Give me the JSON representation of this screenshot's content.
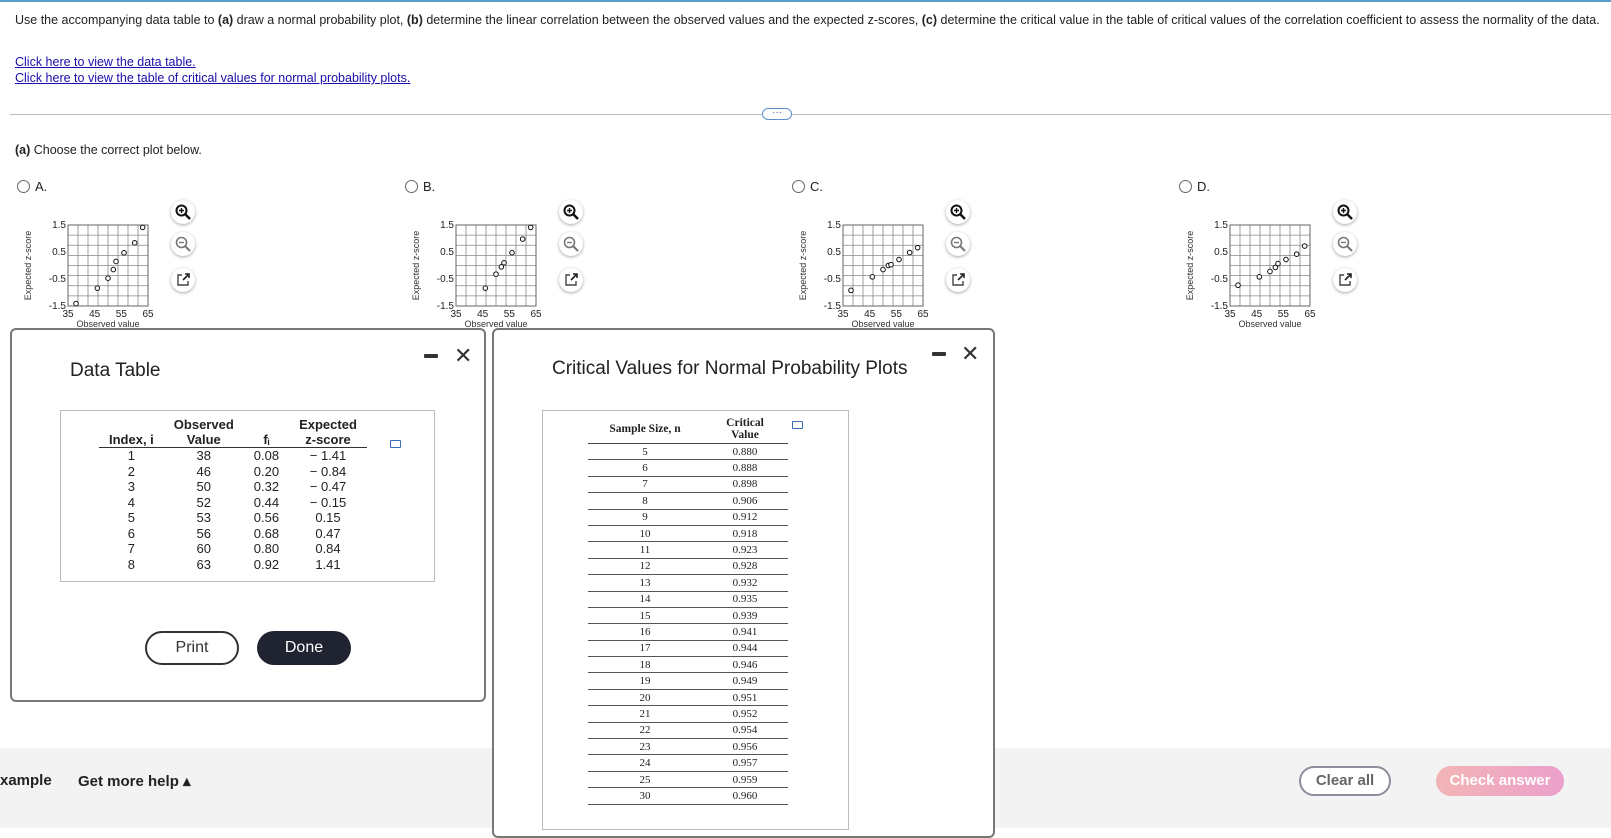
{
  "question": {
    "text_parts": [
      "Use the accompanying data table to ",
      "(a)",
      " draw a normal probability plot, ",
      "(b)",
      " determine the linear correlation between the observed values and the expected z-scores, ",
      "(c)",
      " determine the critical value in the table of critical values of the correlation coefficient to assess the normality of the data."
    ]
  },
  "links": {
    "data_table": "Click here to view the data table.",
    "critical_values": "Click here to view the table of critical values for normal probability plots."
  },
  "more_label": "···",
  "part_a": {
    "bold": "(a)",
    "text": " Choose the correct plot below."
  },
  "plot_axes": {
    "xlabel": "Observed value",
    "ylabel": "Expected z-score",
    "xticks": [
      "35",
      "45",
      "55",
      "65"
    ],
    "yticks": [
      "1.5",
      "0.5",
      "-0.5",
      "-1.5"
    ],
    "xlim": [
      35,
      65
    ],
    "ylim": [
      -1.5,
      1.5
    ]
  },
  "chart_data": [
    {
      "type": "scatter",
      "option": "A.",
      "x": [
        38,
        46,
        50,
        52,
        53,
        56,
        60,
        63
      ],
      "y": [
        -1.41,
        -0.84,
        -0.47,
        -0.15,
        0.15,
        0.47,
        0.84,
        1.41
      ],
      "xlabel": "Observed value",
      "ylabel": "Expected z-score",
      "xlim": [
        35,
        65
      ],
      "ylim": [
        -1.5,
        1.5
      ],
      "grid": true
    },
    {
      "type": "scatter",
      "option": "B.",
      "x": [
        46,
        50,
        52,
        53,
        56,
        60,
        63
      ],
      "y": [
        -0.84,
        -0.32,
        -0.05,
        0.1,
        0.47,
        0.98,
        1.41
      ],
      "xlabel": "Observed value",
      "ylabel": "Expected z-score",
      "xlim": [
        35,
        65
      ],
      "ylim": [
        -1.5,
        1.5
      ],
      "grid": true
    },
    {
      "type": "scatter",
      "option": "C.",
      "x": [
        38,
        46,
        50,
        52,
        53,
        56,
        60,
        63
      ],
      "y": [
        -0.92,
        -0.42,
        -0.15,
        0.0,
        0.03,
        0.22,
        0.48,
        0.66
      ],
      "xlabel": "Observed value",
      "ylabel": "Expected z-score",
      "xlim": [
        35,
        65
      ],
      "ylim": [
        -1.5,
        1.5
      ],
      "grid": true
    },
    {
      "type": "scatter",
      "option": "D.",
      "x": [
        38,
        46,
        50,
        52,
        53,
        56,
        60,
        63
      ],
      "y": [
        -0.73,
        -0.42,
        -0.22,
        -0.07,
        0.07,
        0.22,
        0.42,
        0.72
      ],
      "xlabel": "Observed value",
      "ylabel": "Expected z-score",
      "xlim": [
        35,
        65
      ],
      "ylim": [
        -1.5,
        1.5
      ],
      "grid": true
    }
  ],
  "icons": [
    "zoom-in-icon",
    "zoom-out-icon",
    "external-link-icon"
  ],
  "data_dialog": {
    "title": "Data Table",
    "headers": [
      [
        "",
        "Index, i"
      ],
      [
        "Observed",
        "Value"
      ],
      [
        "",
        "fᵢ"
      ],
      [
        "Expected",
        "z-score"
      ]
    ],
    "rows": [
      [
        "1",
        "38",
        "0.08",
        "− 1.41"
      ],
      [
        "2",
        "46",
        "0.20",
        "− 0.84"
      ],
      [
        "3",
        "50",
        "0.32",
        "− 0.47"
      ],
      [
        "4",
        "52",
        "0.44",
        "− 0.15"
      ],
      [
        "5",
        "53",
        "0.56",
        "0.15"
      ],
      [
        "6",
        "56",
        "0.68",
        "0.47"
      ],
      [
        "7",
        "60",
        "0.80",
        "0.84"
      ],
      [
        "8",
        "63",
        "0.92",
        "1.41"
      ]
    ],
    "print_label": "Print",
    "done_label": "Done"
  },
  "critical_dialog": {
    "title": "Critical Values for Normal Probability Plots",
    "headers": [
      "Sample Size, n",
      "Critical Value"
    ],
    "rows": [
      [
        "5",
        "0.880"
      ],
      [
        "6",
        "0.888"
      ],
      [
        "7",
        "0.898"
      ],
      [
        "8",
        "0.906"
      ],
      [
        "9",
        "0.912"
      ],
      [
        "10",
        "0.918"
      ],
      [
        "11",
        "0.923"
      ],
      [
        "12",
        "0.928"
      ],
      [
        "13",
        "0.932"
      ],
      [
        "14",
        "0.935"
      ],
      [
        "15",
        "0.939"
      ],
      [
        "16",
        "0.941"
      ],
      [
        "17",
        "0.944"
      ],
      [
        "18",
        "0.946"
      ],
      [
        "19",
        "0.949"
      ],
      [
        "20",
        "0.951"
      ],
      [
        "21",
        "0.952"
      ],
      [
        "22",
        "0.954"
      ],
      [
        "23",
        "0.956"
      ],
      [
        "24",
        "0.957"
      ],
      [
        "25",
        "0.959"
      ],
      [
        "30",
        "0.960"
      ]
    ]
  },
  "bottom": {
    "example": "xample",
    "help": "Get more help ▴",
    "clear": "Clear all",
    "check": "Check answer"
  },
  "colors": {
    "link": "#1a0dab",
    "done_button": "#1f2430",
    "check_gradient": [
      "#f2b5b5",
      "#ec9fcb"
    ]
  }
}
